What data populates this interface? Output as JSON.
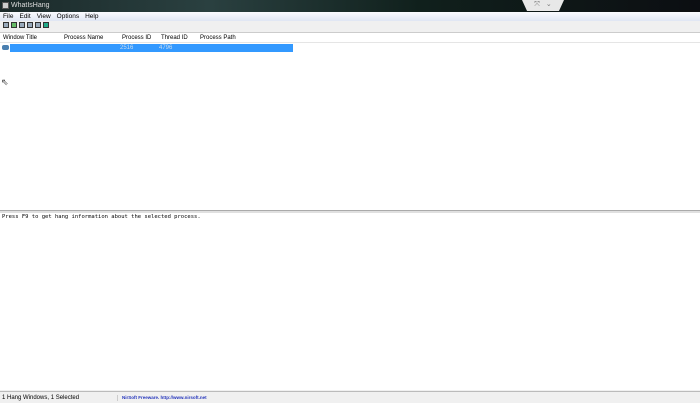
{
  "window": {
    "title": "WhatIsHang"
  },
  "menu": [
    "File",
    "Edit",
    "View",
    "Options",
    "Help"
  ],
  "toolbar": [
    "save-icon",
    "export-icon",
    "copy-icon",
    "properties-icon",
    "find-icon",
    "exit-icon"
  ],
  "columns": [
    "Window Title",
    "Process Name",
    "Process ID",
    "Thread ID",
    "Process Path"
  ],
  "rows": [
    {
      "window_title": "",
      "process_name": "",
      "process_id": "2516",
      "thread_id": "4796",
      "process_path": ""
    }
  ],
  "lower_pane": {
    "text": "Press F9 to get hang information about the selected process."
  },
  "status": {
    "left": "1 Hang Windows, 1 Selected",
    "credit": "NirSoft Freeware.  http://www.nirsoft.net"
  }
}
